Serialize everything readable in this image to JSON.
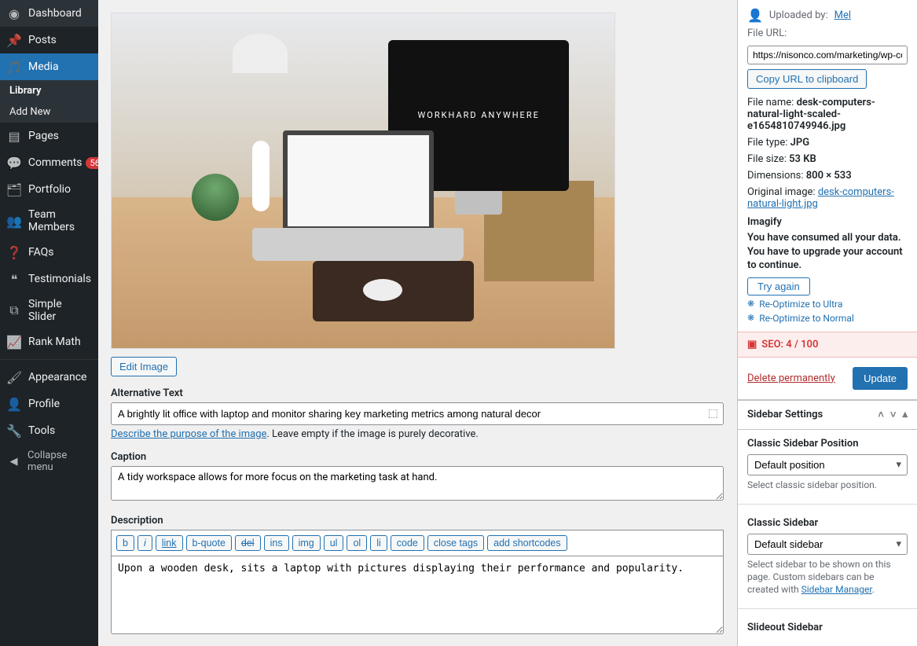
{
  "sidebar": {
    "items": [
      {
        "label": "Dashboard"
      },
      {
        "label": "Posts"
      },
      {
        "label": "Media"
      },
      {
        "label": "Pages"
      },
      {
        "label": "Comments",
        "badge": "56"
      },
      {
        "label": "Portfolio"
      },
      {
        "label": "Team Members"
      },
      {
        "label": "FAQs"
      },
      {
        "label": "Testimonials"
      },
      {
        "label": "Simple Slider"
      },
      {
        "label": "Rank Math"
      },
      {
        "label": "Appearance"
      },
      {
        "label": "Profile"
      },
      {
        "label": "Tools"
      }
    ],
    "media_sub": {
      "library": "Library",
      "add_new": "Add New"
    },
    "collapse": "Collapse menu"
  },
  "main": {
    "monitor_text": "WORKHARD ANYWHERE",
    "edit_image": "Edit Image",
    "alt_label": "Alternative Text",
    "alt_value": "A brightly lit office with laptop and monitor sharing key marketing metrics among natural decor",
    "alt_help_link": "Describe the purpose of the image",
    "alt_help_rest": ". Leave empty if the image is purely decorative.",
    "caption_label": "Caption",
    "caption_value": "A tidy workspace allows for more focus on the marketing task at hand.",
    "desc_label": "Description",
    "desc_value": "Upon a wooden desk, sits a laptop with pictures displaying their performance and popularity.",
    "toolbar": [
      "b",
      "i",
      "link",
      "b-quote",
      "del",
      "ins",
      "img",
      "ul",
      "ol",
      "li",
      "code",
      "close tags",
      "add shortcodes"
    ]
  },
  "details": {
    "uploaded_by_label": "Uploaded by:",
    "uploaded_by_user": "Mel",
    "file_url_label": "File URL:",
    "file_url_value": "https://nisonco.com/marketing/wp-co",
    "copy_url": "Copy URL to clipboard",
    "file_name_label": "File name:",
    "file_name_value": "desk-computers-natural-light-scaled-e1654810749946.jpg",
    "file_type_label": "File type:",
    "file_type_value": "JPG",
    "file_size_label": "File size:",
    "file_size_value": "53 KB",
    "dimensions_label": "Dimensions:",
    "dimensions_value": "800 × 533",
    "original_label": "Original image:",
    "original_link": "desk-computers-natural-light.jpg",
    "imagify_title": "Imagify",
    "imagify_msg": "You have consumed all your data. You have to upgrade your account to continue.",
    "try_again": "Try again",
    "reopt_ultra": "Re-Optimize to Ultra",
    "reopt_normal": "Re-Optimize to Normal",
    "seo": "SEO: 4 / 100",
    "delete": "Delete permanently",
    "update": "Update",
    "sidebar_settings": "Sidebar Settings",
    "classic_pos_label": "Classic Sidebar Position",
    "classic_pos_value": "Default position",
    "classic_pos_help": "Select classic sidebar position.",
    "classic_sidebar_label": "Classic Sidebar",
    "classic_sidebar_value": "Default sidebar",
    "classic_sidebar_help_1": "Select sidebar to be shown on this page. Custom sidebars can be created with ",
    "classic_sidebar_help_link": "Sidebar Manager",
    "slideout_label": "Slideout Sidebar"
  }
}
